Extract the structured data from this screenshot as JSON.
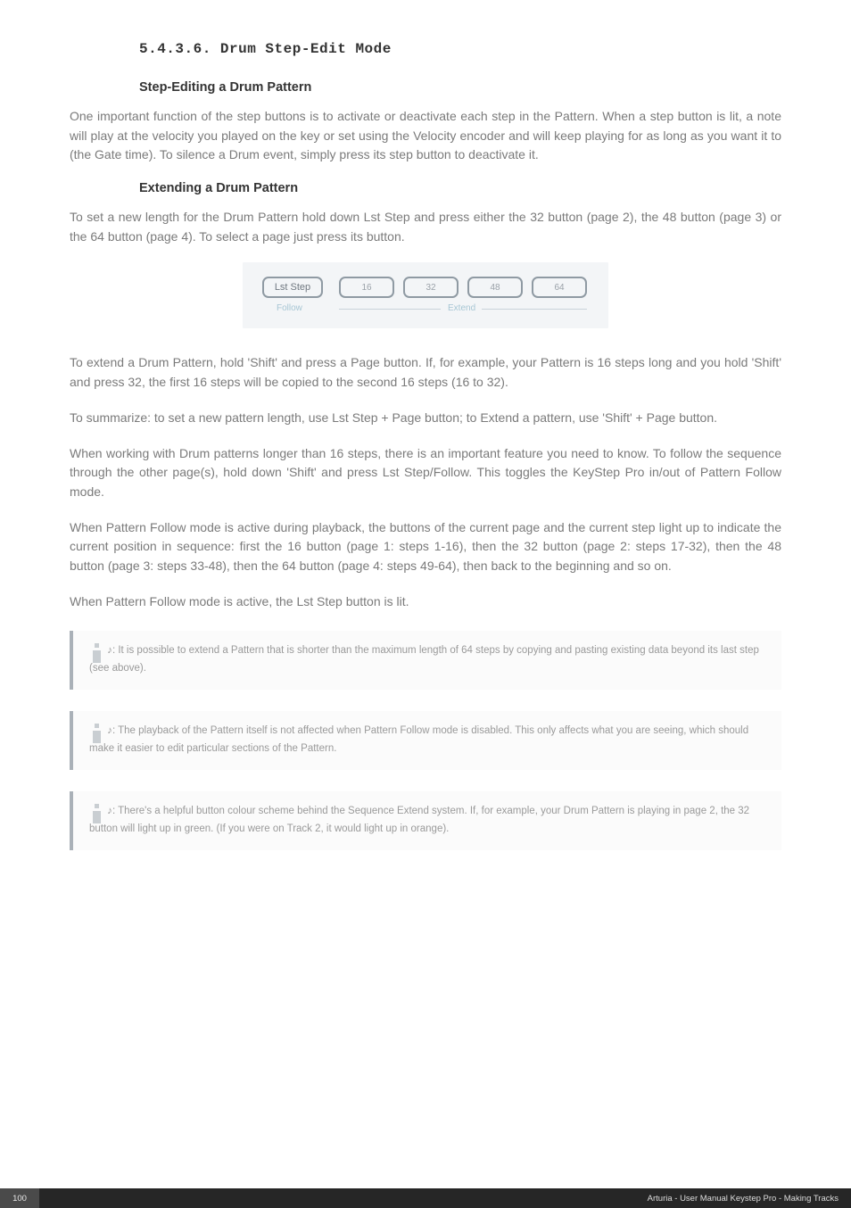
{
  "section_number": "5.4.3.6. Drum Step-Edit Mode",
  "subheading1": "Step-Editing a Drum Pattern",
  "para1": "One important function of the step buttons is to activate or deactivate each step in the Pattern. When a step button is lit, a note will play at the velocity you played on the key or set using the Velocity encoder and will keep playing for as long as you want it to (the Gate time). To silence a Drum event, simply press its step button to deactivate it.",
  "subheading2": "Extending a Drum Pattern",
  "para2": "To set a new length for the Drum Pattern hold down Lst Step and press either the 32 button (page 2), the 48 button (page 3) or the 64 button (page 4). To select a page just press its button.",
  "image": {
    "lst_step": "Lst Step",
    "b16": "16",
    "b32": "32",
    "b48": "48",
    "b64": "64",
    "follow": "Follow",
    "extend": "Extend"
  },
  "para3": "To extend a Drum Pattern, hold 'Shift' and press a Page button. If, for example, your Pattern is 16 steps long and you hold 'Shift' and press 32, the first 16 steps will be copied to the second 16 steps (16 to 32).",
  "para4": "To summarize: to set a new pattern length, use Lst Step + Page button; to Extend a pattern, use 'Shift' + Page button.",
  "para5": "When working with Drum patterns longer than 16 steps, there is an important feature you need to know. To follow the sequence through the other page(s), hold down 'Shift' and press Lst Step/Follow. This toggles the KeyStep Pro in/out of Pattern Follow mode.",
  "para6": "When Pattern Follow mode is active during playback, the buttons of the current page and the current step light up to indicate the current position in sequence: first the 16 button (page 1: steps 1-16), then the 32 button (page 2: steps 17-32), then the 48 button (page 3: steps 33-48), then the 64 button (page 4: steps 49-64), then back to the beginning and so on.",
  "para7": "When Pattern Follow mode is active, the Lst Step button is lit.",
  "callout1": " ♪: It is possible to extend a Pattern that is shorter than the maximum length of 64 steps by copying and pasting existing data beyond its last step (see above).",
  "callout2": " ♪: The playback of the Pattern itself is not affected when Pattern Follow mode is disabled. This only affects what you are seeing, which should make it easier to edit particular sections of the Pattern.",
  "callout3": " ♪: There's a helpful button colour scheme behind the Sequence Extend system. If, for example, your Drum Pattern is playing in page 2, the 32 button will light up in green. (If you were on Track 2, it would light up in orange).",
  "footer": {
    "page": "100",
    "right": "Arturia - User Manual Keystep Pro - Making Tracks"
  }
}
